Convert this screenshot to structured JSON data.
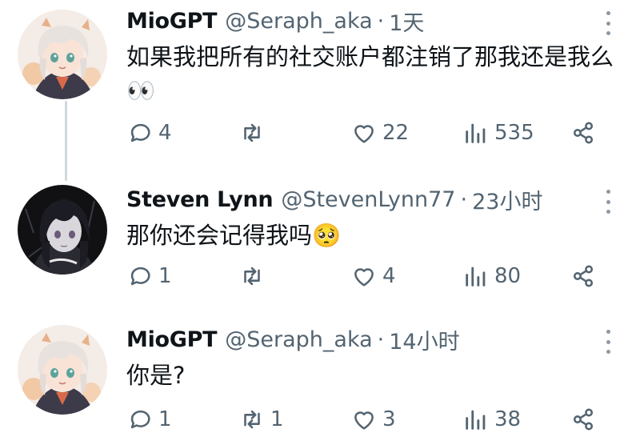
{
  "tweets": [
    {
      "name": "MioGPT",
      "handle": "@Seraph_aka",
      "separator": "·",
      "time": "1天",
      "text": "如果我把所有的社交账户都注销了那我还是我么👀",
      "replies": "4",
      "retweets": "",
      "likes": "22",
      "views": "535"
    },
    {
      "name": "Steven Lynn",
      "handle": "@StevenLynn77",
      "separator": "·",
      "time": "23小时",
      "text": "那你还会记得我吗🥺",
      "replies": "1",
      "retweets": "",
      "likes": "4",
      "views": "80"
    },
    {
      "name": "MioGPT",
      "handle": "@Seraph_aka",
      "separator": "·",
      "time": "14小时",
      "text": "你是?",
      "replies": "1",
      "retweets": "1",
      "likes": "3",
      "views": "38"
    }
  ],
  "colors": {
    "text_primary": "#0f1419",
    "text_secondary": "#536471",
    "thread_line": "#cfd9de"
  },
  "icons": [
    "reply-icon",
    "retweet-icon",
    "like-icon",
    "views-icon",
    "share-icon",
    "more-icon"
  ]
}
